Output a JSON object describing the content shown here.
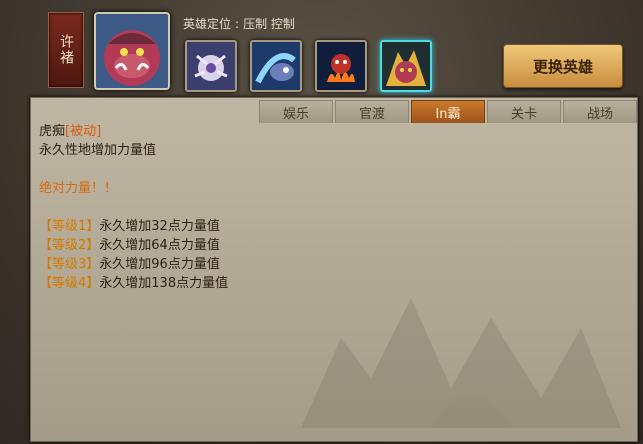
{
  "hero": {
    "banner_name": "许褚",
    "role_label": "英雄定位",
    "roles": "压制 控制",
    "change_button": "更换英雄"
  },
  "skills": [
    {
      "icon": "skill-1-icon"
    },
    {
      "icon": "skill-2-icon"
    },
    {
      "icon": "skill-3-icon"
    },
    {
      "icon": "skill-4-icon",
      "selected": true
    }
  ],
  "tabs": [
    {
      "label": "娱乐"
    },
    {
      "label": "官渡"
    },
    {
      "label": "In霸",
      "active": true
    },
    {
      "label": "关卡"
    },
    {
      "label": "战场"
    }
  ],
  "skill_detail": {
    "name": "虎痴",
    "type": "[被动]",
    "summary": "永久性地增加力量值",
    "flavor": "绝对力量！！",
    "levels": [
      {
        "tag": "【等级1】",
        "desc": "永久增加32点力量值"
      },
      {
        "tag": "【等级2】",
        "desc": "永久增加64点力量值"
      },
      {
        "tag": "【等级3】",
        "desc": "永久增加96点力量值"
      },
      {
        "tag": "【等级4】",
        "desc": "永久增加138点力量值"
      }
    ]
  }
}
